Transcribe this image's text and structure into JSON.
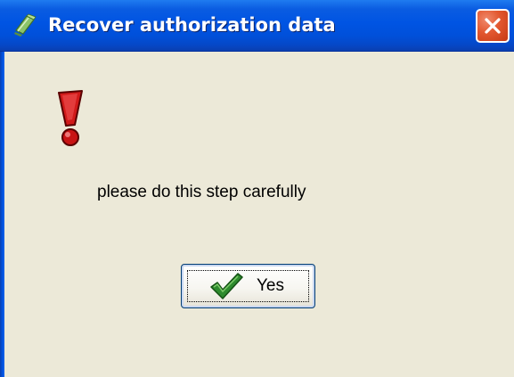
{
  "window": {
    "title": "Recover authorization data",
    "app_icon": "app-icon",
    "close_icon": "close-icon"
  },
  "dialog": {
    "icon": "exclamation-icon",
    "message": "please do this step carefully",
    "yes_button": {
      "label": "Yes",
      "icon": "checkmark-icon"
    }
  },
  "colors": {
    "titlebar": "#0054E3",
    "dialog_background": "#ECE9D8",
    "close_button": "#E2572F",
    "warning_red": "#D11A1A",
    "check_green": "#2E8B2E"
  }
}
